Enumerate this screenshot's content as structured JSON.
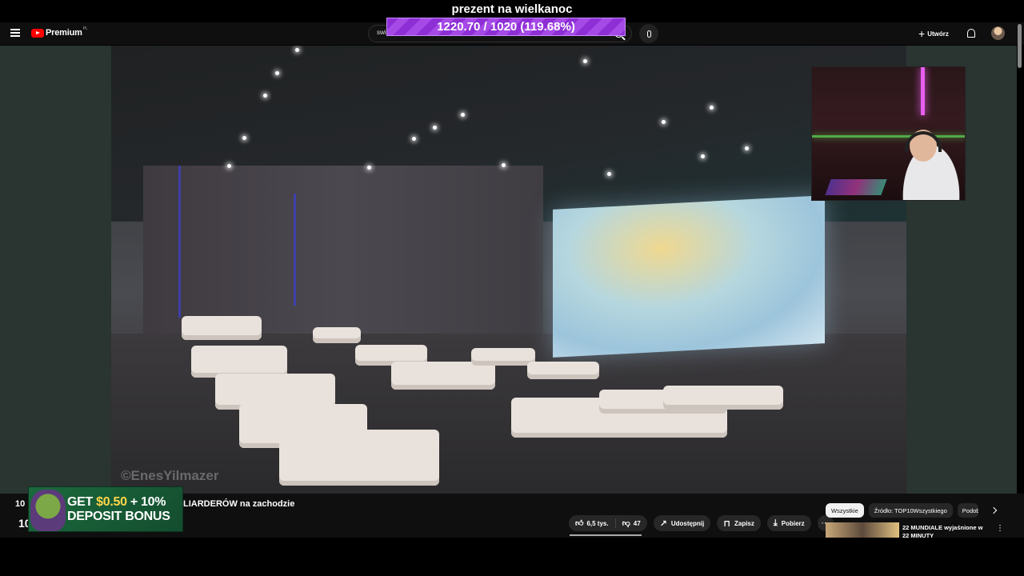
{
  "overlay": {
    "title": "prezent na wielkanoc",
    "goal_text": "1220.70 / 1020 (119.68%)"
  },
  "header": {
    "logo_text": "Premium",
    "logo_region": "PL",
    "search_value": "swiat milionera",
    "create_label": "Utwórz"
  },
  "video": {
    "watermark": "©EnesYilmazer"
  },
  "below": {
    "title_prefix": "10",
    "title_prefix2": "10",
    "title_visible": "LIARDERÓW na zachodzie",
    "ad": {
      "line1_pre": "GET ",
      "line1_highlight": "$0.50",
      "line1_post": " + 10%",
      "line2": "DEPOSIT BONUS"
    },
    "like_count": "6,5 tys.",
    "dislike_count": "47",
    "share_label": "Udostępnij",
    "save_label": "Zapisz",
    "download_label": "Pobierz",
    "more_label": "⋯"
  },
  "sidebar": {
    "chips": [
      "Wszystkie",
      "Źródło: TOP10Wszystkiego",
      "Podob"
    ],
    "rec_title": "22 MUNDIALE wyjaśnione w 22 MINUTY"
  },
  "colors": {
    "yt_bg": "#0f0f0f",
    "brand_red": "#ff0000",
    "goal_purple": "#a54ae6",
    "ad_green": "#1b6a3c"
  }
}
